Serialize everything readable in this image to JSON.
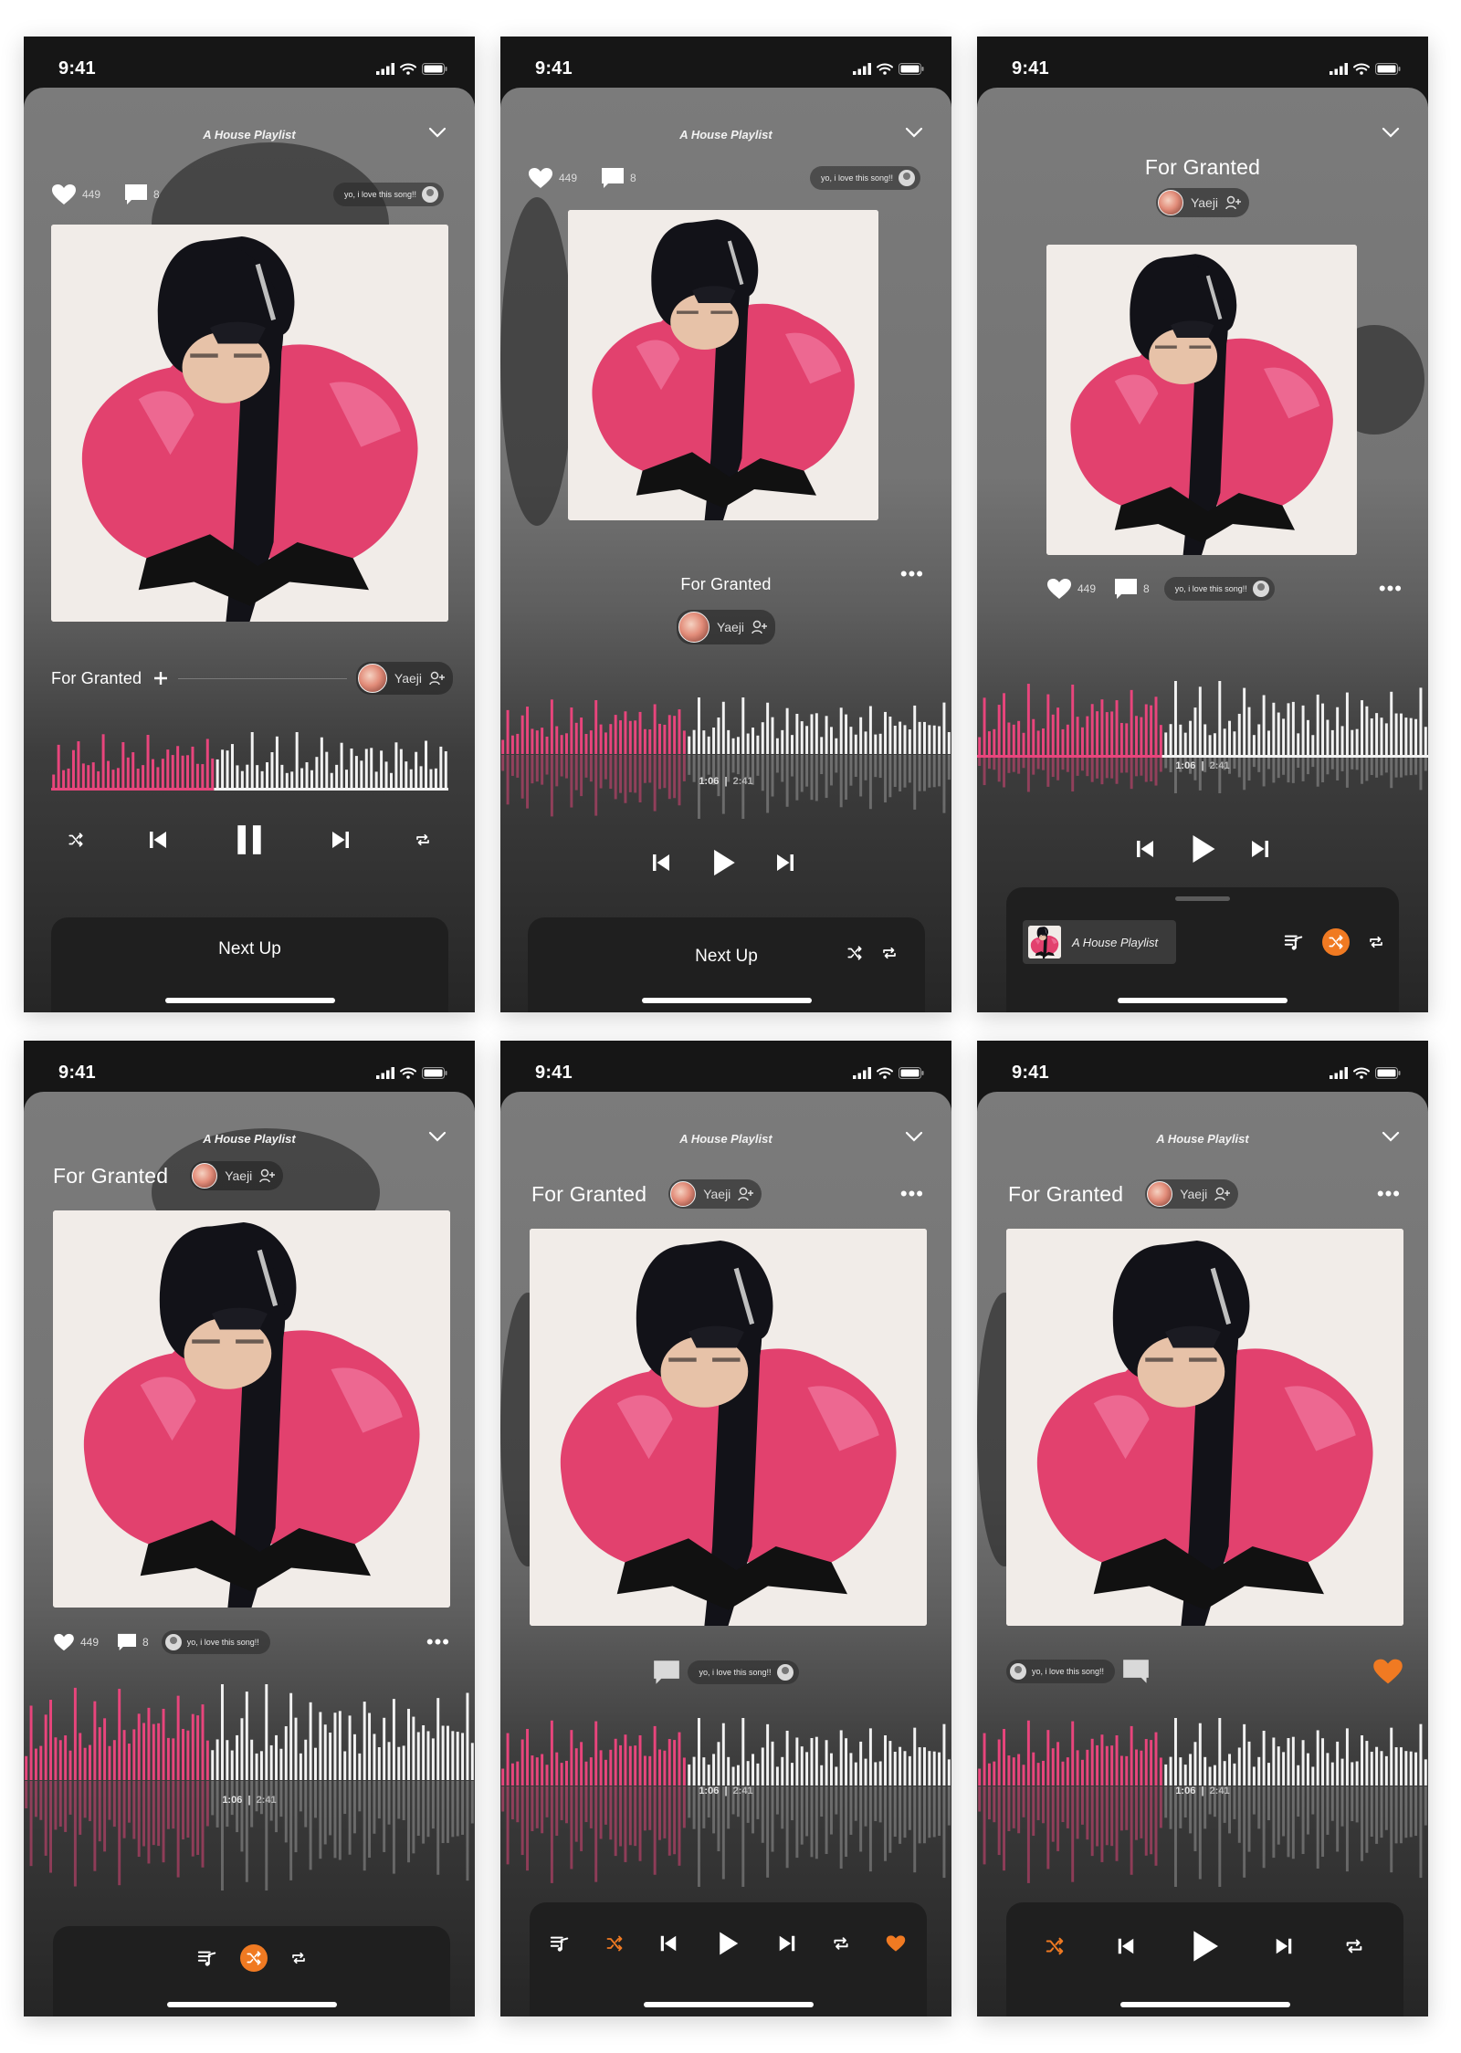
{
  "status": {
    "time": "9:41"
  },
  "playlist": {
    "title": "A House Playlist"
  },
  "song": {
    "title": "For Granted",
    "artist": "Yaeji"
  },
  "social": {
    "likes": "449",
    "comments": "8",
    "comment_text": "yo, i love this song!!"
  },
  "playback": {
    "elapsed": "1:06",
    "duration": "2:41",
    "progress": 0.41
  },
  "labels": {
    "next_up": "Next Up",
    "mini_playlist": "A House Playlist"
  },
  "colors": {
    "accent_pink": "#e8457c",
    "accent_orange": "#f07a22",
    "sheet_gray": "#777777",
    "panel_dark": "#1f1f1f"
  },
  "icons": [
    "signal-icon",
    "wifi-icon",
    "battery-icon",
    "chevron-down-icon",
    "heart-icon",
    "comment-icon",
    "user-icon",
    "add-user-icon",
    "plus-icon",
    "shuffle-icon",
    "previous-icon",
    "play-icon",
    "pause-icon",
    "next-icon",
    "repeat-icon",
    "queue-icon",
    "more-icon"
  ]
}
